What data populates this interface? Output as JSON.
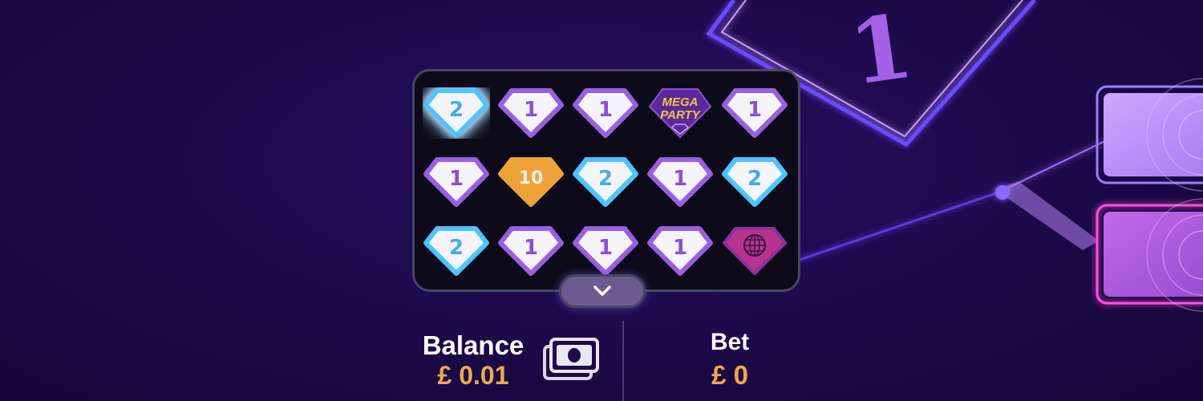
{
  "colors": {
    "accent_orange": "#f0a94c",
    "neon_purple": "#b06cff",
    "gem_blue": "#4dc4ff",
    "gem_purple": "#9a5fe0",
    "gem_orange": "#f0a23a",
    "panel_border": "#4a4560"
  },
  "board": {
    "rows": [
      [
        {
          "kind": "gem",
          "color": "blue",
          "value": "2",
          "highlighted": true
        },
        {
          "kind": "gem",
          "color": "purple",
          "value": "1"
        },
        {
          "kind": "gem",
          "color": "purple",
          "value": "1"
        },
        {
          "kind": "mega-party",
          "line1": "MEGA",
          "line2": "PARTY"
        },
        {
          "kind": "gem",
          "color": "purple",
          "value": "1"
        }
      ],
      [
        {
          "kind": "gem",
          "color": "purple",
          "value": "1"
        },
        {
          "kind": "gem",
          "color": "orange",
          "value": "10"
        },
        {
          "kind": "gem",
          "color": "blue",
          "value": "2"
        },
        {
          "kind": "gem",
          "color": "purple",
          "value": "1"
        },
        {
          "kind": "gem",
          "color": "blue",
          "value": "2"
        }
      ],
      [
        {
          "kind": "gem",
          "color": "blue",
          "value": "2"
        },
        {
          "kind": "gem",
          "color": "purple",
          "value": "1"
        },
        {
          "kind": "gem",
          "color": "purple",
          "value": "1"
        },
        {
          "kind": "gem",
          "color": "purple",
          "value": "1"
        },
        {
          "kind": "disco-ball",
          "icon": "disco-ball-icon"
        }
      ]
    ]
  },
  "toggle": {
    "icon": "chevron-down-icon"
  },
  "footer": {
    "balance_label": "Balance",
    "balance_value": "£ 0.01",
    "wallet_icon": "cash-stack-icon",
    "bet_label": "Bet",
    "bet_value": "£ 0"
  },
  "background": {
    "big_number": "1",
    "icons": [
      "neon-diamond-outline",
      "neon-light-beam",
      "side-tile-light",
      "side-tile-pink"
    ]
  }
}
